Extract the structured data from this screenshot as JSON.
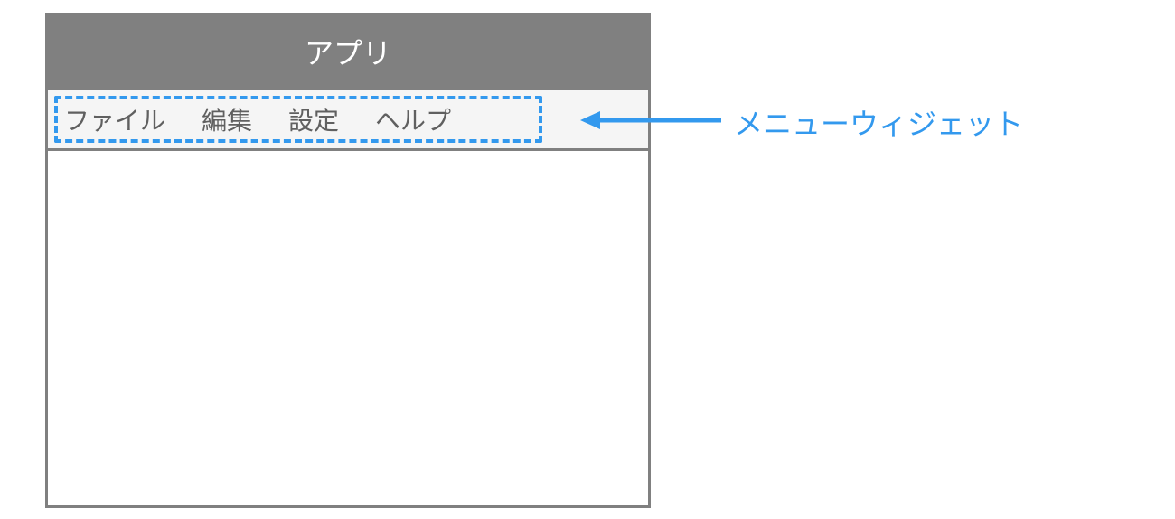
{
  "window": {
    "title": "アプリ"
  },
  "menu": {
    "items": [
      {
        "label": "ファイル"
      },
      {
        "label": "編集"
      },
      {
        "label": "設定"
      },
      {
        "label": "ヘルプ"
      }
    ]
  },
  "annotation": {
    "label": "メニューウィジェット"
  },
  "colors": {
    "accent": "#3399ee",
    "titlebar": "#808080",
    "menubar": "#f5f5f5",
    "text_muted": "#606060",
    "title_text": "#ffffff"
  }
}
